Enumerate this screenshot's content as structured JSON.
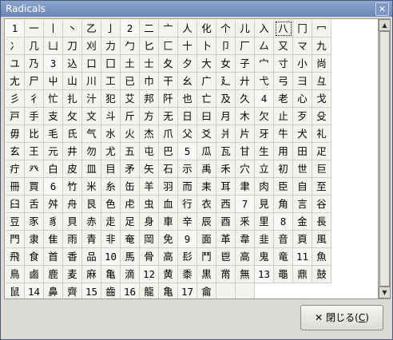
{
  "window": {
    "title": "Radicals"
  },
  "close_button": {
    "label": "閉じる(",
    "mnemonic": "C",
    "label_end": ")"
  },
  "radicals": [
    "1",
    "一",
    "丨",
    "丶",
    "乙",
    "亅",
    "2",
    "二",
    "亠",
    "人",
    "化",
    "个",
    "儿",
    "入",
    "八",
    "冂",
    "冖",
    "冫",
    "几",
    "凵",
    "刀",
    "刈",
    "力",
    "勹",
    "匕",
    "匚",
    "十",
    "卜",
    "卩",
    "厂",
    "厶",
    "又",
    "マ",
    "九",
    "ユ",
    "乃",
    "3",
    "込",
    "口",
    "囗",
    "土",
    "士",
    "夂",
    "夕",
    "大",
    "女",
    "子",
    "宀",
    "寸",
    "小",
    "尚",
    "尢",
    "尸",
    "屮",
    "山",
    "川",
    "工",
    "已",
    "巾",
    "干",
    "幺",
    "广",
    "廴",
    "廾",
    "弋",
    "弓",
    "彐",
    "彑",
    "彡",
    "彳",
    "忙",
    "扎",
    "汁",
    "犯",
    "艾",
    "邦",
    "阡",
    "也",
    "亡",
    "及",
    "久",
    "4",
    "老",
    "心",
    "戈",
    "戸",
    "手",
    "支",
    "攵",
    "文",
    "斗",
    "斤",
    "方",
    "无",
    "日",
    "曰",
    "月",
    "木",
    "欠",
    "止",
    "歹",
    "殳",
    "毋",
    "比",
    "毛",
    "氏",
    "气",
    "水",
    "火",
    "杰",
    "爪",
    "父",
    "爻",
    "爿",
    "片",
    "牙",
    "牛",
    "犬",
    "礼",
    "玄",
    "王",
    "元",
    "井",
    "勿",
    "尤",
    "五",
    "屯",
    "巴",
    "5",
    "瓜",
    "瓦",
    "甘",
    "生",
    "用",
    "田",
    "疋",
    "疔",
    "癶",
    "白",
    "皮",
    "皿",
    "目",
    "矛",
    "矢",
    "石",
    "示",
    "禹",
    "禾",
    "穴",
    "立",
    "初",
    "世",
    "巨",
    "冊",
    "買",
    "6",
    "竹",
    "米",
    "糸",
    "缶",
    "羊",
    "羽",
    "而",
    "耒",
    "耳",
    "聿",
    "肉",
    "臣",
    "自",
    "至",
    "臼",
    "舌",
    "舛",
    "舟",
    "艮",
    "色",
    "虍",
    "虫",
    "血",
    "行",
    "衣",
    "西",
    "7",
    "見",
    "角",
    "言",
    "谷",
    "豆",
    "豕",
    "豸",
    "貝",
    "赤",
    "走",
    "足",
    "身",
    "車",
    "辛",
    "辰",
    "酉",
    "釆",
    "里",
    "8",
    "金",
    "長",
    "門",
    "隶",
    "隹",
    "雨",
    "青",
    "非",
    "奄",
    "岡",
    "免",
    "9",
    "面",
    "革",
    "韋",
    "韭",
    "音",
    "頁",
    "風",
    "飛",
    "食",
    "首",
    "香",
    "品",
    "10",
    "馬",
    "骨",
    "高",
    "髟",
    "鬥",
    "鬯",
    "高",
    "鬼",
    "竜",
    "11",
    "魚",
    "鳥",
    "鹵",
    "鹿",
    "麦",
    "麻",
    "亀",
    "滴",
    "12",
    "黄",
    "黍",
    "黒",
    "黹",
    "無",
    "13",
    "黽",
    "鼎",
    "鼓",
    "鼠",
    "14",
    "鼻",
    "齊",
    "15",
    "齒",
    "16",
    "龍",
    "亀",
    "17",
    "龠",
    "",
    ""
  ],
  "stroke_markers": [
    "1",
    "2",
    "3",
    "4",
    "5",
    "6",
    "7",
    "8",
    "9",
    "10",
    "11",
    "12",
    "13",
    "14",
    "15",
    "16",
    "17"
  ],
  "selected_radical": "八"
}
